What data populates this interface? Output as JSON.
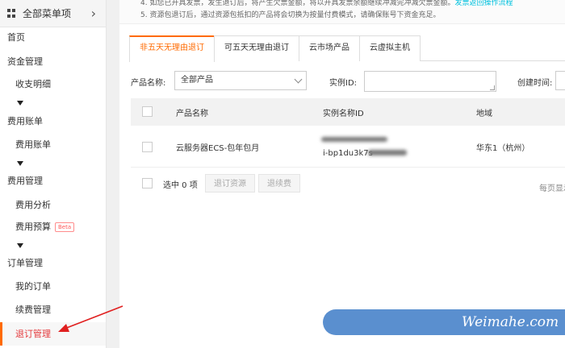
{
  "sidebar": {
    "title": "全部菜单项",
    "items": [
      {
        "label": "首页",
        "level": 1
      },
      {
        "label": "资金管理",
        "level": 1
      },
      {
        "label": "收支明细",
        "level": 2
      },
      {
        "label": "费用账单",
        "level": 1
      },
      {
        "label": "费用账单",
        "level": 2
      },
      {
        "label": "费用管理",
        "level": 1
      },
      {
        "label": "费用分析",
        "level": 2
      },
      {
        "label": "费用预算",
        "level": 2,
        "badge": "Beta"
      },
      {
        "label": "订单管理",
        "level": 1
      },
      {
        "label": "我的订单",
        "level": 2
      },
      {
        "label": "续费管理",
        "level": 2
      },
      {
        "label": "退订管理",
        "level": 2,
        "active": true
      }
    ]
  },
  "notice": {
    "line1": "4. 如您已开具发票，发生退订后，将产生欠票金额，将以开具发票余额继续冲减完冲减欠票金额。",
    "line1_link": "发票返回操作流程",
    "line2": "5. 资源包退订后，通过资源包抵扣的产品将会切换为按量付费模式，请确保账号下资金充足。"
  },
  "tabs": [
    {
      "label": "非五天无理由退订",
      "active": true
    },
    {
      "label": "可五天无理由退订",
      "active": false
    },
    {
      "label": "云市场产品",
      "active": false
    },
    {
      "label": "云虚拟主机",
      "active": false
    }
  ],
  "filters": {
    "product_label": "产品名称:",
    "product_value": "全部产品",
    "instance_label": "实例ID:",
    "instance_value": "",
    "created_label": "创建时间:"
  },
  "table": {
    "headers": [
      "产品名称",
      "实例名称ID",
      "地域"
    ],
    "rows": [
      {
        "product": "云服务器ECS-包年包月",
        "instance_id": "i-bp1du3k7s",
        "region": "华东1（杭州）"
      }
    ]
  },
  "footer": {
    "selected": "选中 0 项",
    "refund_button": "退订资源",
    "renew_button": "退续费",
    "page_info": "每页显示"
  },
  "watermark": {
    "text": "Weimahe.com"
  },
  "colors": {
    "accent": "#ff6a00",
    "active_text": "#e4393c",
    "link": "#00c1de",
    "watermark_bg": "#5a8fcf",
    "arrow": "#e02020"
  }
}
